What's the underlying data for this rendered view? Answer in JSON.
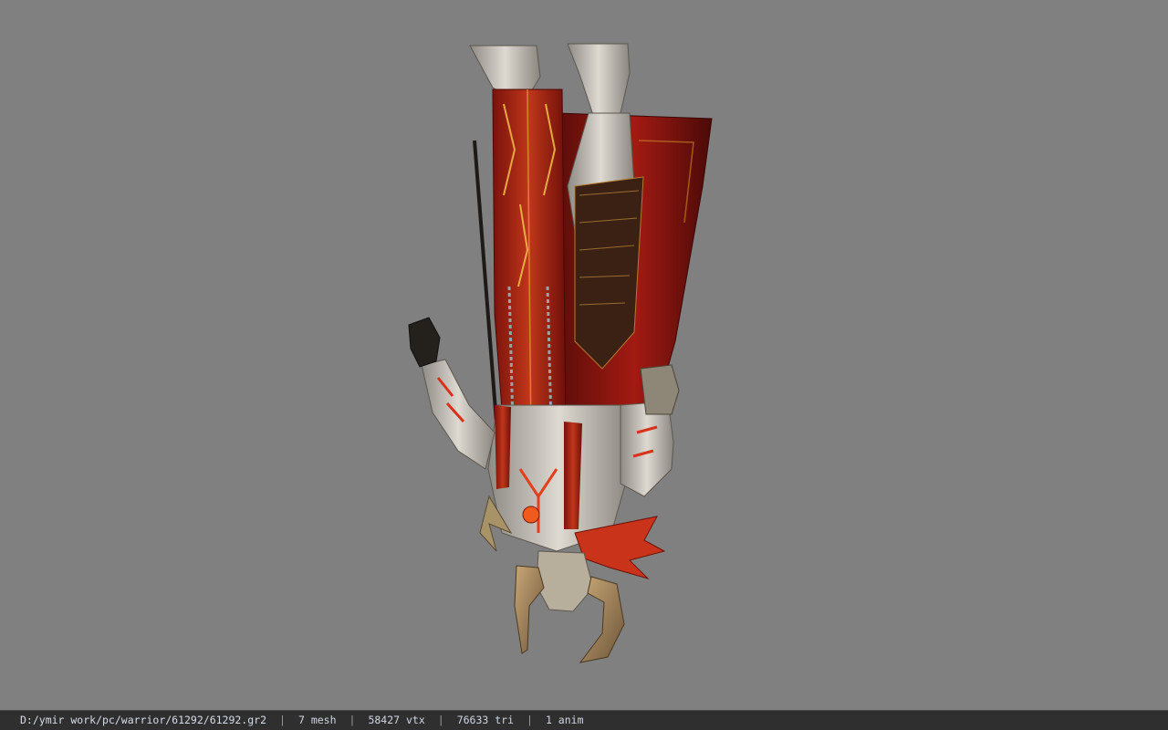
{
  "viewer": {
    "background_color": "#808080",
    "model_icon": "armored-warrior-model"
  },
  "statusbar": {
    "file_path": "D:/ymir work/pc/warrior/61292/61292.gr2",
    "separator": "|",
    "mesh_count": "7 mesh",
    "vertex_count": "58427 vtx",
    "triangle_count": "76633 tri",
    "anim_count": "1 anim"
  }
}
